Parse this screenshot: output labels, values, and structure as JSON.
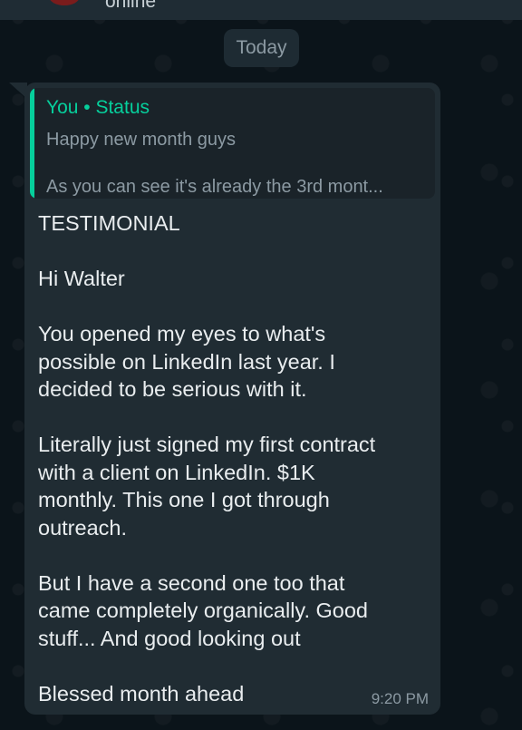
{
  "header": {
    "status": "online"
  },
  "date_chip": "Today",
  "message": {
    "quote": {
      "author": "You • Status",
      "line1": "Happy new month guys",
      "line2": "As you can see it's already the 3rd mont..."
    },
    "paragraphs": [
      "TESTIMONIAL",
      "Hi Walter",
      "You opened my eyes to what's\npossible on LinkedIn last year. I\ndecided to be serious with it.",
      "Literally just signed my first contract\nwith a client on LinkedIn. $1K\nmonthly. This one I got through\noutreach.",
      "But I have a second one too that\ncame completely organically. Good\nstuff... And good looking out",
      "Blessed month ahead"
    ],
    "time": "9:20 PM"
  },
  "colors": {
    "background": "#0b141a",
    "bubble": "#202c33",
    "quote_accent": "#06cf9c",
    "text": "#e9edef",
    "muted": "#8c9aa3"
  }
}
